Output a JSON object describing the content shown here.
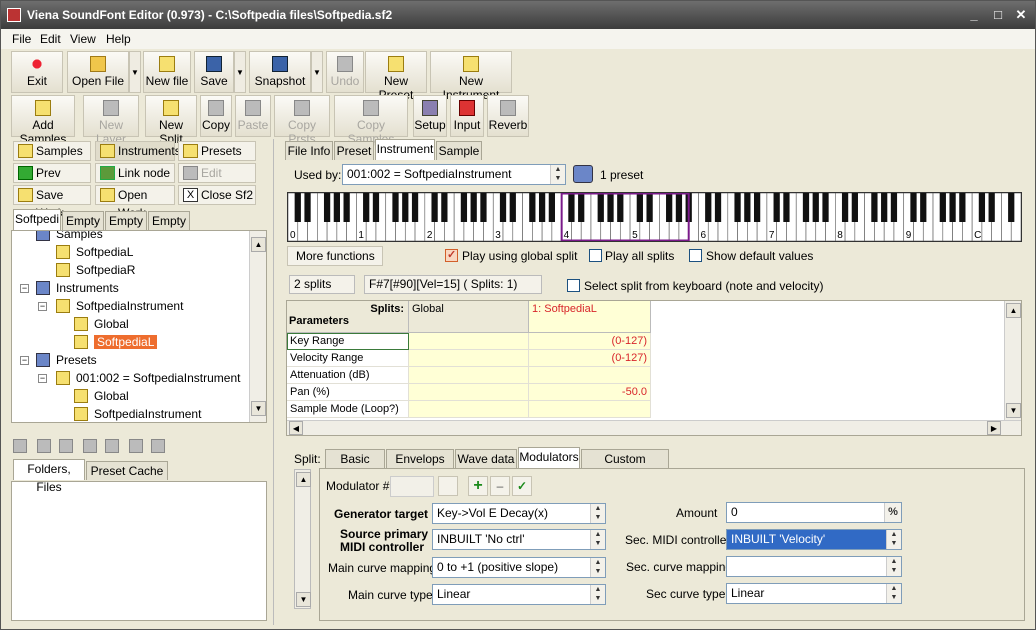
{
  "window": {
    "title": "Viena SoundFont Editor (0.973) - C:\\Softpedia files\\Softpedia.sf2"
  },
  "menu": {
    "items": [
      "File",
      "Edit",
      "View",
      "Help"
    ]
  },
  "toolbar1": {
    "exit": "Exit",
    "open_file": "Open File",
    "new_file": "New file",
    "save": "Save",
    "snapshot": "Snapshot",
    "undo": "Undo",
    "new_preset": "New Preset",
    "new_instrument": "New Instrument"
  },
  "toolbar2": {
    "add_samples": "Add Samples",
    "new_layer": "New Layer",
    "new_split": "New Split",
    "copy": "Copy",
    "paste": "Paste",
    "copy_prsts": "Copy Prsts",
    "copy_samples": "Copy Samples",
    "setup": "Setup",
    "input": "Input",
    "reverb": "Reverb"
  },
  "nav": {
    "samples": "Samples",
    "instruments": "Instruments",
    "presets": "Presets",
    "prev_node": "Prev node",
    "link_node": "Link node",
    "edit_name": "Edit name",
    "save_work": "Save Work",
    "open_work": "Open Work",
    "close_sf2": "Close Sf2"
  },
  "tree_tabs": [
    "Softpedi",
    "Empty",
    "Empty",
    "Empty"
  ],
  "tree": {
    "samples_top": "Samples",
    "sample1": "SoftpediaL",
    "sample2": "SoftpediaR",
    "instruments": "Instruments",
    "instrument": "SoftpediaInstrument",
    "inst_global": "Global",
    "inst_split": "SoftpediaL",
    "presets": "Presets",
    "preset": "001:002 = SoftpediaInstrument",
    "preset_global": "Global",
    "preset_split": "SoftpediaInstrument"
  },
  "lower_tabs": [
    "Folders, Files",
    "Preset Cache"
  ],
  "main_tabs": [
    "File Info",
    "Preset",
    "Instrument",
    "Sample"
  ],
  "used_by": {
    "label": "Used by:",
    "value": "001:002 = SoftpediaInstrument",
    "count": "1 preset"
  },
  "piano": {
    "octaves": [
      "0",
      "1",
      "2",
      "3",
      "4",
      "5",
      "6",
      "7",
      "8",
      "9",
      "C"
    ]
  },
  "options": {
    "more_functions": "More functions ...",
    "global_split": "Play using global split",
    "all_splits": "Play all splits",
    "default_values": "Show default values",
    "select_split": "Select split from keyboard (note and velocity)"
  },
  "splits_info": {
    "count": "2 splits",
    "status": "F#7[#90][Vel=15] ( Splits: 1)"
  },
  "grid": {
    "corner_top": "Splits:",
    "corner_bottom": "Parameters",
    "col_global": "Global",
    "col_split": "1: SoftpediaL",
    "rows": [
      {
        "name": "Key Range",
        "global": "",
        "split": "(0-127)"
      },
      {
        "name": "Velocity Range",
        "global": "",
        "split": "(0-127)"
      },
      {
        "name": "Attenuation (dB)",
        "global": "",
        "split": ""
      },
      {
        "name": "Pan (%)",
        "global": "",
        "split": "-50.0"
      },
      {
        "name": "Sample Mode (Loop?)",
        "global": "",
        "split": ""
      }
    ]
  },
  "split_tabs": {
    "label": "Split:",
    "tabs": [
      "Basic",
      "Envelops",
      "Wave data",
      "Modulators",
      "Custom Features"
    ]
  },
  "modulator": {
    "label": "Modulator #",
    "value": "",
    "gen_target_label": "Generator target",
    "gen_target": "Key->Vol E Decay(x)",
    "source_label_1": "Source primary",
    "source_label_2": "MIDI controller",
    "source": "INBUILT 'No ctrl'",
    "main_curve_label": "Main curve mapping",
    "main_curve": "0 to +1  (positive slope)",
    "main_type_label": "Main curve type",
    "main_type": "Linear",
    "amount_label": "Amount",
    "amount": "0",
    "sec_midi_label": "Sec. MIDI controller",
    "sec_midi": "INBUILT 'Velocity'",
    "sec_curve_label": "Sec. curve mapping",
    "sec_curve": "",
    "sec_type_label": "Sec curve type",
    "sec_type": "Linear"
  },
  "colors": {
    "accent": "#ee6d2e",
    "grid_yellow": "#ffffd6",
    "split_red": "#d8262b",
    "selection_blue": "#316ac5"
  }
}
